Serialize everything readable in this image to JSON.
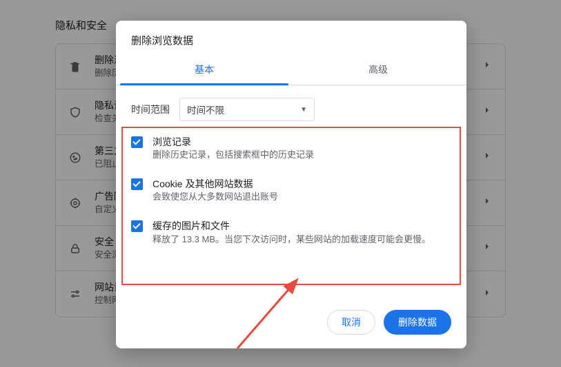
{
  "page": {
    "section_title": "隐私和安全",
    "rows": [
      {
        "icon": "trash",
        "label": "删除浏览数据",
        "sub": "删除历史记录、Cookie、缓存及其他数据"
      },
      {
        "icon": "shield",
        "label": "隐私设置指南",
        "sub": "检查关键的隐私和安全控制设置"
      },
      {
        "icon": "cookie",
        "label": "第三方 Cookie",
        "sub": "已阻止无痕模式下的第三方 Cookie"
      },
      {
        "icon": "target",
        "label": "广告隐私权设置",
        "sub": "自定义广告主可使用哪些信息向您展示广告"
      },
      {
        "icon": "lock",
        "label": "安全",
        "sub": "安全浏览（保护您免受危险网站的侵害）和其他安全设置"
      },
      {
        "icon": "sliders",
        "label": "网站设置",
        "sub": "控制网站可以使用和显示的内容（如位置信息、摄像头、弹出式窗口等）"
      }
    ]
  },
  "dialog": {
    "title": "删除浏览数据",
    "tabs": {
      "basic": "基本",
      "advanced": "高级",
      "active": "basic"
    },
    "time_range": {
      "label": "时间范围",
      "value": "时间不限"
    },
    "items": [
      {
        "title": "浏览记录",
        "sub": "删除历史记录，包括搜索框中的历史记录",
        "checked": true
      },
      {
        "title": "Cookie 及其他网站数据",
        "sub": "会致使您从大多数网站退出账号",
        "checked": true
      },
      {
        "title": "缓存的图片和文件",
        "sub": "释放了 13.3 MB。当您下次访问时，某些网站的加载速度可能会更慢。",
        "checked": true
      }
    ],
    "buttons": {
      "cancel": "取消",
      "confirm": "删除数据"
    }
  }
}
